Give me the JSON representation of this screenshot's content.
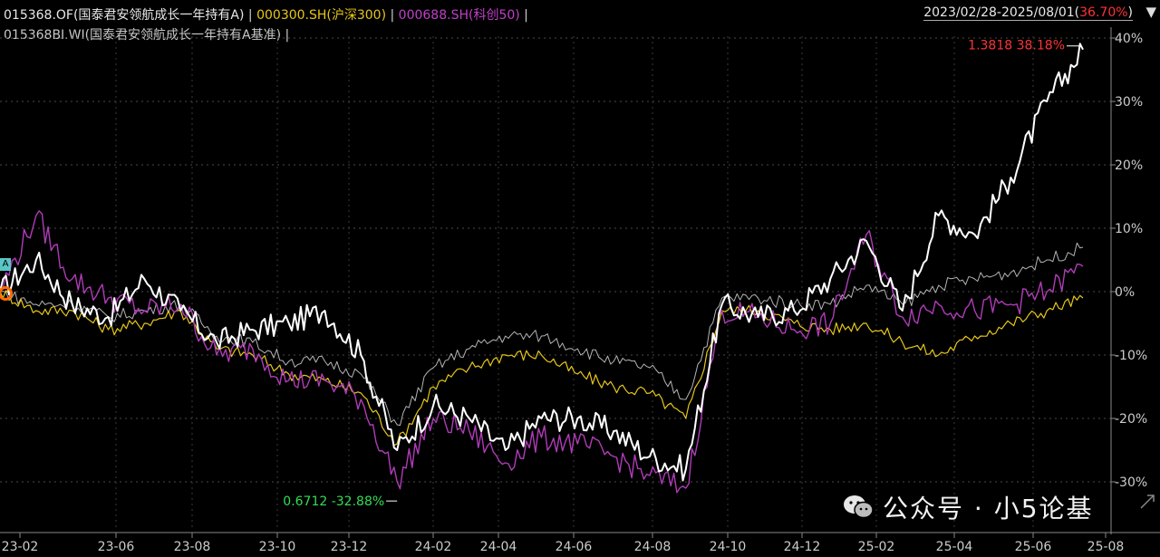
{
  "legend": {
    "fund": "015368.OF(国泰君安领航成长一年持有A)",
    "csi300": "000300.SH(沪深300)",
    "star50": "000688.SH(科创50)",
    "benchmark": "015368BI.WI(国泰君安领航成长一年持有A基准)",
    "separator": " | "
  },
  "range": {
    "dates": "2023/02/28-2025/08/01(",
    "return": "36.70%",
    "close": ")"
  },
  "flag_label": "A",
  "watermark": "公众号 · 小5论基",
  "annotations": {
    "max": "1.3818 38.18%",
    "min": "0.6712 -32.88%"
  },
  "colors": {
    "background": "#000000",
    "fund": "#ffffff",
    "csi300": "#e6c619",
    "star50": "#b03cb8",
    "benchmark": "#b4b4b4",
    "max_label": "#ff3333",
    "min_label": "#33dd55"
  },
  "chart_data": {
    "type": "line",
    "xlabel": "",
    "ylabel": "",
    "x_ticks": [
      "23-02",
      "23-06",
      "23-08",
      "23-10",
      "23-12",
      "24-02",
      "24-04",
      "24-06",
      "24-08",
      "24-10",
      "24-12",
      "25-02",
      "25-04",
      "25-06",
      "25-08"
    ],
    "y_ticks": [
      "40%",
      "30%",
      "20%",
      "10%",
      "0%",
      "-10%",
      "-20%",
      "-30%"
    ],
    "ylim": [
      -33,
      42
    ],
    "x": [
      "2023-02",
      "2023-03",
      "2023-04",
      "2023-05",
      "2023-06",
      "2023-07",
      "2023-08",
      "2023-09",
      "2023-10",
      "2023-11",
      "2023-12",
      "2024-01",
      "2024-02",
      "2024-03",
      "2024-04",
      "2024-05",
      "2024-06",
      "2024-07",
      "2024-08",
      "2024-09",
      "2024-10",
      "2024-11",
      "2024-12",
      "2025-01",
      "2025-02",
      "2025-03",
      "2025-04",
      "2025-05",
      "2025-06",
      "2025-07",
      "2025-08"
    ],
    "series": [
      {
        "name": "015368.OF(国泰君安领航成长一年持有A)",
        "values": [
          0,
          5,
          -2,
          -4,
          2,
          -3,
          -8,
          -6,
          -5,
          -3,
          -10,
          -25,
          -18,
          -20,
          -25,
          -20,
          -20,
          -22,
          -26,
          -28,
          -2,
          -4,
          -3,
          2,
          8,
          -3,
          12,
          9,
          18,
          30,
          38.18
        ]
      },
      {
        "name": "000300.SH(沪深300)",
        "values": [
          0,
          -3,
          -3,
          -6,
          -5,
          -3,
          -9,
          -10,
          -13,
          -14,
          -16,
          -24,
          -15,
          -12,
          -10,
          -10,
          -13,
          -15,
          -16,
          -20,
          -3,
          -3,
          -5,
          -6,
          -5,
          -8,
          -10,
          -7,
          -5,
          -3,
          -1
        ]
      },
      {
        "name": "000688.SH(科创50)",
        "values": [
          0,
          12,
          2,
          -1,
          -3,
          -2,
          -10,
          -9,
          -14,
          -14,
          -17,
          -30,
          -20,
          -22,
          -27,
          -23,
          -24,
          -26,
          -29,
          -31,
          -3,
          -4,
          -6,
          -5,
          9,
          -4,
          -2,
          -3,
          -2,
          0,
          4
        ]
      },
      {
        "name": "015368BI.WI(国泰君安领航成长一年持有A基准)",
        "values": [
          0,
          -2,
          -2,
          -4,
          -3,
          -2,
          -7,
          -8,
          -11,
          -11,
          -13,
          -21,
          -12,
          -9,
          -7,
          -7,
          -9,
          -11,
          -12,
          -17,
          -1,
          -1,
          -2,
          -2,
          1,
          -2,
          1,
          2,
          3,
          5,
          7
        ]
      }
    ]
  }
}
